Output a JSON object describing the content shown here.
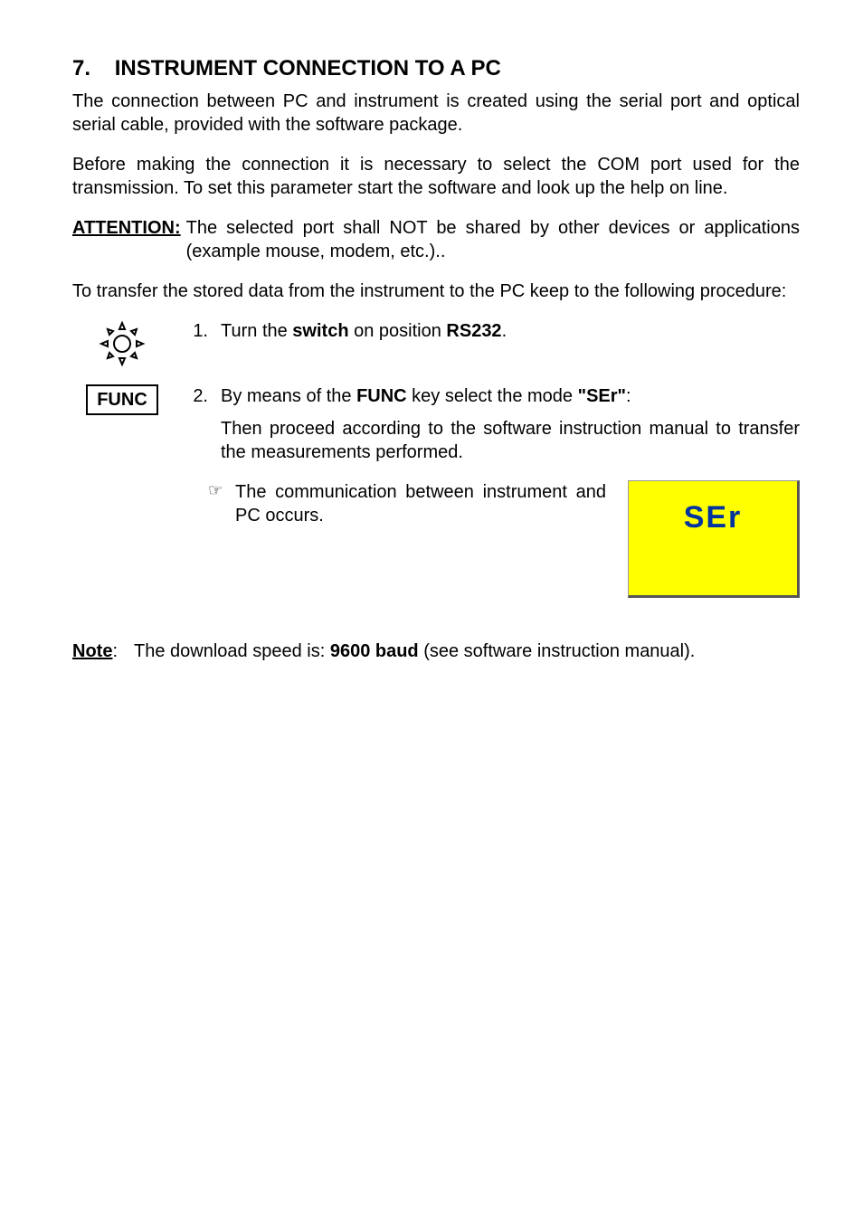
{
  "heading_number": "7.",
  "heading_text": "INSTRUMENT CONNECTION TO A PC",
  "para_intro": "The connection between PC and instrument is created using the serial port and optical serial cable, provided with the software package.",
  "para_before": "Before making the connection it is necessary to select the COM port used for the transmission. To set this parameter start the software and look up the help on line.",
  "attention_label": "ATTENTION:",
  "attention_text": "The selected port shall NOT be shared by other devices or applications (example mouse, modem, etc.)..",
  "para_transfer": "To transfer the stored data from the instrument to the PC keep to the following procedure:",
  "func_label": "FUNC",
  "step1": {
    "num": "1.",
    "pre": "Turn the ",
    "bold1": "switch",
    "mid": " on position ",
    "bold2": "RS232",
    "post": "."
  },
  "step2": {
    "num": "2.",
    "pre": "By means of the ",
    "bold1": "FUNC",
    "mid": " key select the mode ",
    "bold2": "\"SEr\"",
    "post": ":",
    "sub": "Then proceed according to the software instruction manual to transfer the measurements performed."
  },
  "hand_icon": "☞",
  "comm_text": "The communication between instrument and PC occurs.",
  "lcd_value": "SEr",
  "note_label": "Note",
  "note_colon": ":",
  "note_pre": "The download speed is: ",
  "note_bold": "9600 baud",
  "note_post": " (see software instruction manual)."
}
